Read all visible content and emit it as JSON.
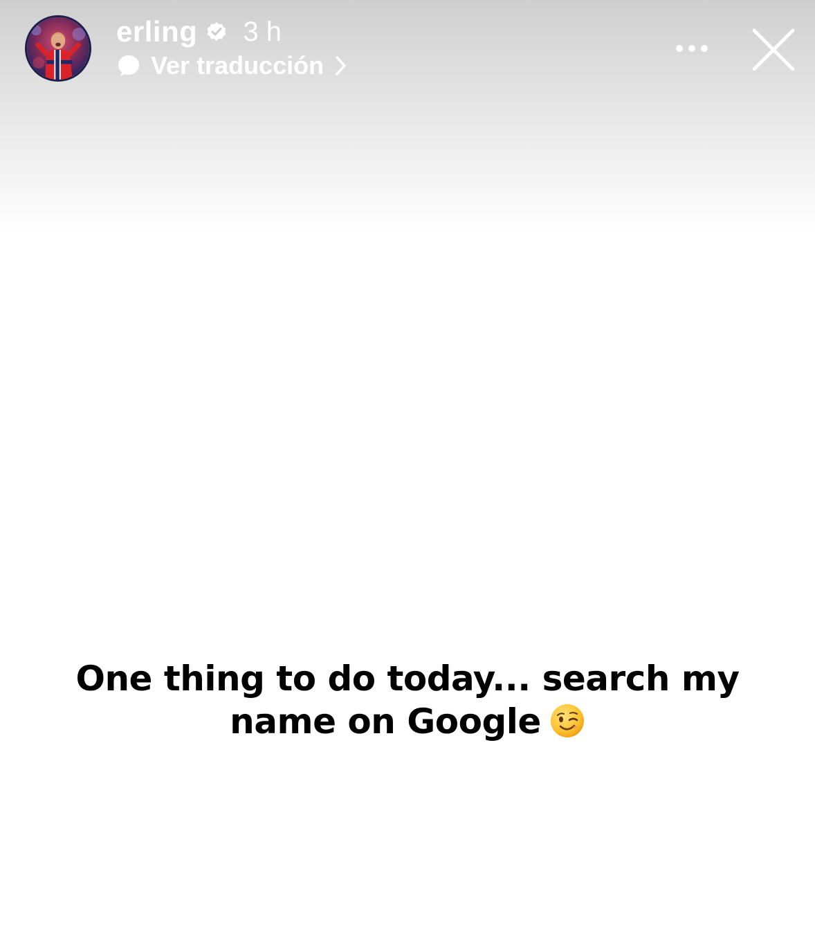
{
  "header": {
    "username": "erling",
    "timestamp": "3 h",
    "translate_label": "Ver traducción"
  },
  "story": {
    "caption_line1": "One thing to do today... search my",
    "caption_line2": "name on Google"
  },
  "icons": {
    "verified": "verified-badge-icon",
    "translate": "speech-bubble-icon",
    "chevron": "chevron-right-icon",
    "more": "more-options-icon",
    "close": "close-icon",
    "emoji": "winking-face-emoji"
  },
  "colors": {
    "header_text": "#ffffff",
    "caption_text": "#000000",
    "background": "#ffffff",
    "gradient_top": "#cfcfcf"
  }
}
